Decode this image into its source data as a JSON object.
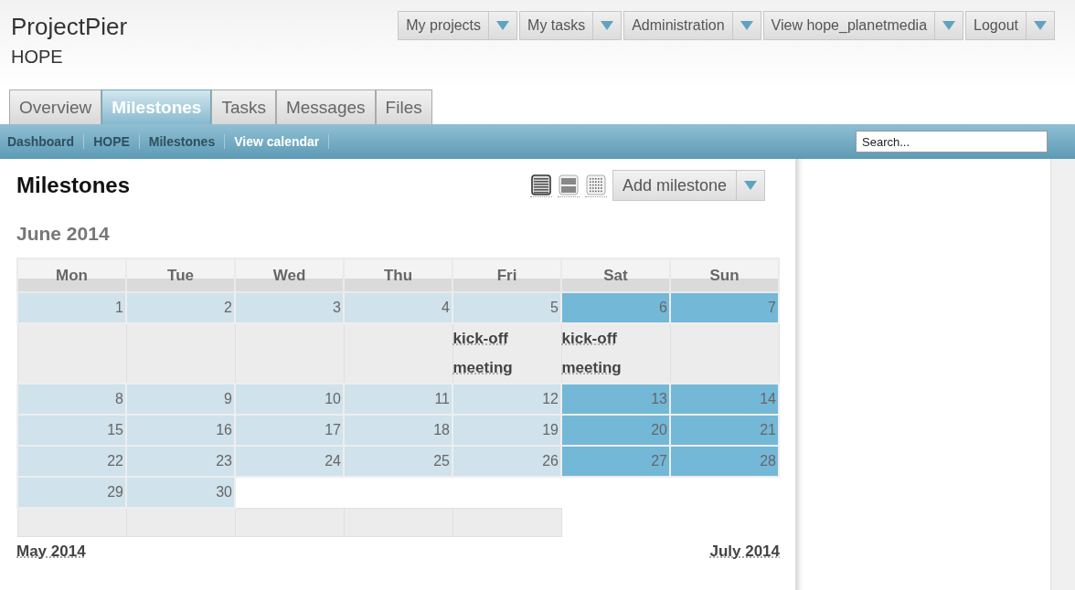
{
  "logo": "ProjectPier",
  "project": "HOPE",
  "top_menu": [
    {
      "label": "My projects"
    },
    {
      "label": "My tasks"
    },
    {
      "label": "Administration"
    },
    {
      "label": "View hope_planetmedia"
    },
    {
      "label": "Logout"
    }
  ],
  "tabs": [
    {
      "label": "Overview",
      "selected": false
    },
    {
      "label": "Milestones",
      "selected": true
    },
    {
      "label": "Tasks",
      "selected": false
    },
    {
      "label": "Messages",
      "selected": false
    },
    {
      "label": "Files",
      "selected": false
    }
  ],
  "breadcrumbs": [
    {
      "label": "Dashboard",
      "selected": false
    },
    {
      "label": "HOPE",
      "selected": false
    },
    {
      "label": "Milestones",
      "selected": false
    },
    {
      "label": "View calendar",
      "selected": true
    }
  ],
  "search": {
    "placeholder": "Search..."
  },
  "page_title": "Milestones",
  "view_modes": [
    {
      "kind": "list",
      "selected": true
    },
    {
      "kind": "rows",
      "selected": false
    },
    {
      "kind": "grid",
      "selected": false
    }
  ],
  "add_button": "Add milestone",
  "calendar": {
    "month": "June 2014",
    "weekdays": [
      "Mon",
      "Tue",
      "Wed",
      "Thu",
      "Fri",
      "Sat",
      "Sun"
    ],
    "weeks": [
      {
        "days": [
          {
            "day": "1",
            "weekend": false
          },
          {
            "day": "2",
            "weekend": false
          },
          {
            "day": "3",
            "weekend": false
          },
          {
            "day": "4",
            "weekend": false
          },
          {
            "day": "5",
            "weekend": false,
            "milestones": [
              "kick-off meeting"
            ]
          },
          {
            "day": "6",
            "weekend": true,
            "milestones": [
              "kick-off meeting"
            ]
          },
          {
            "day": "7",
            "weekend": true
          }
        ],
        "event_row": true
      },
      {
        "days": [
          {
            "day": "8",
            "weekend": false
          },
          {
            "day": "9",
            "weekend": false
          },
          {
            "day": "10",
            "weekend": false
          },
          {
            "day": "11",
            "weekend": false
          },
          {
            "day": "12",
            "weekend": false
          },
          {
            "day": "13",
            "weekend": true
          },
          {
            "day": "14",
            "weekend": true
          }
        ]
      },
      {
        "days": [
          {
            "day": "15",
            "weekend": false
          },
          {
            "day": "16",
            "weekend": false
          },
          {
            "day": "17",
            "weekend": false
          },
          {
            "day": "18",
            "weekend": false
          },
          {
            "day": "19",
            "weekend": false
          },
          {
            "day": "20",
            "weekend": true
          },
          {
            "day": "21",
            "weekend": true
          }
        ]
      },
      {
        "days": [
          {
            "day": "22",
            "weekend": false
          },
          {
            "day": "23",
            "weekend": false
          },
          {
            "day": "24",
            "weekend": false
          },
          {
            "day": "25",
            "weekend": false
          },
          {
            "day": "26",
            "weekend": false
          },
          {
            "day": "27",
            "weekend": true
          },
          {
            "day": "28",
            "weekend": true
          }
        ]
      },
      {
        "days": [
          {
            "day": "29",
            "weekend": false
          },
          {
            "day": "30",
            "weekend": false
          }
        ],
        "event_row": true
      }
    ],
    "previous": "May 2014",
    "next": "July 2014"
  }
}
